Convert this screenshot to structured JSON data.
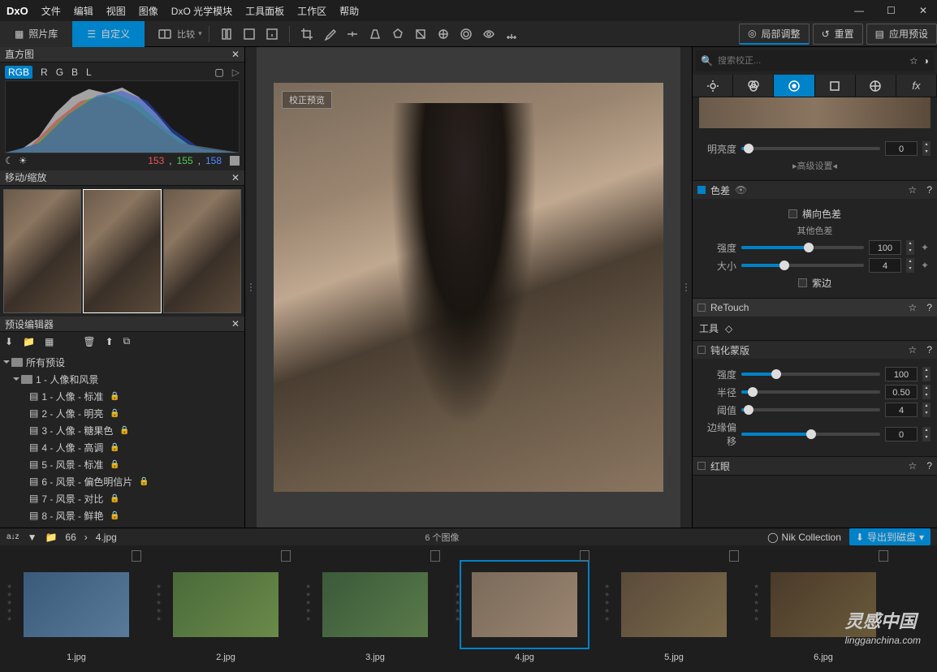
{
  "menu": {
    "logo": "DxO",
    "items": [
      "文件",
      "编辑",
      "视图",
      "图像",
      "DxO 光学模块",
      "工具面板",
      "工作区",
      "帮助"
    ]
  },
  "topbar": {
    "library": "照片库",
    "custom": "自定义",
    "compare": "比较",
    "local_adjust": "局部调整",
    "reset": "重置",
    "apply_preset": "应用预设"
  },
  "histogram": {
    "title": "直方图",
    "rgb": "RGB",
    "r": "R",
    "g": "G",
    "b": "B",
    "l": "L",
    "vals": {
      "r": "153",
      "g": "155",
      "b": "158"
    }
  },
  "nav": {
    "title": "移动/缩放"
  },
  "preset": {
    "title": "预设编辑器",
    "root": "所有预设",
    "group": "1 - 人像和风景",
    "items": [
      "1 - 人像 - 标准",
      "2 - 人像 - 明亮",
      "3 - 人像 - 糖果色",
      "4 - 人像 - 高调",
      "5 - 风景 - 标准",
      "6 - 风景 - 偏色明信片",
      "7 - 风景 - 对比",
      "8 - 风景 - 鲜艳"
    ]
  },
  "canvas": {
    "tag": "校正预览"
  },
  "search": {
    "placeholder": "搜索校正..."
  },
  "right": {
    "brightness": {
      "label": "明亮度",
      "value": "0",
      "advanced": "▸高级设置◂"
    },
    "ca": {
      "title": "色差",
      "lateral": "横向色差",
      "other": "其他色差",
      "intensity": {
        "label": "强度",
        "value": "100"
      },
      "size": {
        "label": "大小",
        "value": "4"
      },
      "purple": "紫边"
    },
    "retouch": {
      "title": "ReTouch",
      "tool": "工具"
    },
    "usm": {
      "title": "钝化蒙版",
      "intensity": {
        "label": "强度",
        "value": "100"
      },
      "radius": {
        "label": "半径",
        "value": "0.50"
      },
      "threshold": {
        "label": "阈值",
        "value": "4"
      },
      "edge": {
        "label": "边缘偏移",
        "value": "0"
      }
    },
    "redeye": {
      "title": "红眼"
    }
  },
  "bottom": {
    "sort": "66",
    "current": "4.jpg",
    "count": "6 个图像",
    "nik": "Nik Collection",
    "export": "导出到磁盘"
  },
  "thumbs": [
    {
      "name": "1.jpg"
    },
    {
      "name": "2.jpg"
    },
    {
      "name": "3.jpg"
    },
    {
      "name": "4.jpg"
    },
    {
      "name": "5.jpg"
    },
    {
      "name": "6.jpg"
    }
  ],
  "watermark": {
    "brand": "灵感中国",
    "url": "lingganchina.com"
  }
}
